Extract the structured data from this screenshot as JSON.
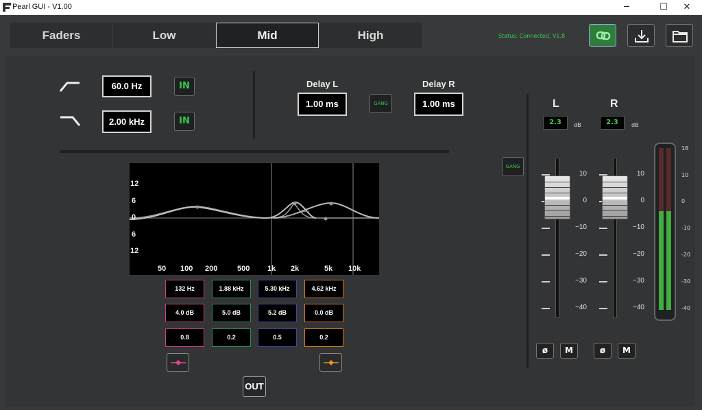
{
  "window": {
    "title": "Pearl GUI - V1.00",
    "minimize": "─",
    "maximize": "☐",
    "close": "✕"
  },
  "tabs": [
    {
      "label": "Faders"
    },
    {
      "label": "Low"
    },
    {
      "label": "Mid"
    },
    {
      "label": "High"
    }
  ],
  "active_tab": "Mid",
  "status": "Status: Connected, V1.8",
  "toolbar": {
    "link_icon": "link-icon",
    "download_icon": "download-icon",
    "folder_icon": "folder-icon",
    "accent": "#2e7d3d"
  },
  "filters": {
    "highpass": {
      "value": "60.0 Hz",
      "in_label": "IN"
    },
    "lowpass": {
      "value": "2.00 kHz",
      "in_label": "IN"
    }
  },
  "delay": {
    "left_label": "Delay L",
    "left_value": "1.00 ms",
    "gang_label": "GANG",
    "right_label": "Delay R",
    "right_value": "1.00 ms"
  },
  "graph": {
    "y_labels": [
      "12",
      "6",
      "0",
      "6",
      "12"
    ],
    "x_labels": [
      "50",
      "100",
      "200",
      "500",
      "1k",
      "2k",
      "5k",
      "10k"
    ]
  },
  "bands": [
    {
      "freq": "132 Hz",
      "gain": "4.0 dB",
      "q": "0.8",
      "color": "#d03a86"
    },
    {
      "freq": "1.88 kHz",
      "gain": "5.0 dB",
      "q": "0.2",
      "color": "#2e8f60"
    },
    {
      "freq": "5.30 kHz",
      "gain": "5.2 dB",
      "q": "0.5",
      "color": "#3b4aa0"
    },
    {
      "freq": "4.62 kHz",
      "gain": "0.0 dB",
      "q": "0.2",
      "color": "#d97a1e"
    }
  ],
  "out_label": "OUT",
  "faders": {
    "gang_label": "GANG",
    "left": {
      "label": "L",
      "db": "2.3",
      "unit": "dB",
      "phase": "ø",
      "mute": "M"
    },
    "right": {
      "label": "R",
      "db": "2.3",
      "unit": "dB",
      "phase": "ø",
      "mute": "M"
    },
    "scale": [
      "10",
      "0",
      "−10",
      "−20",
      "−30",
      "−40"
    ]
  },
  "meter": {
    "scale": [
      "18",
      "10",
      "0",
      "-10",
      "-20",
      "-30",
      "-40"
    ],
    "left_level": 0.61,
    "right_level": 0.61
  }
}
